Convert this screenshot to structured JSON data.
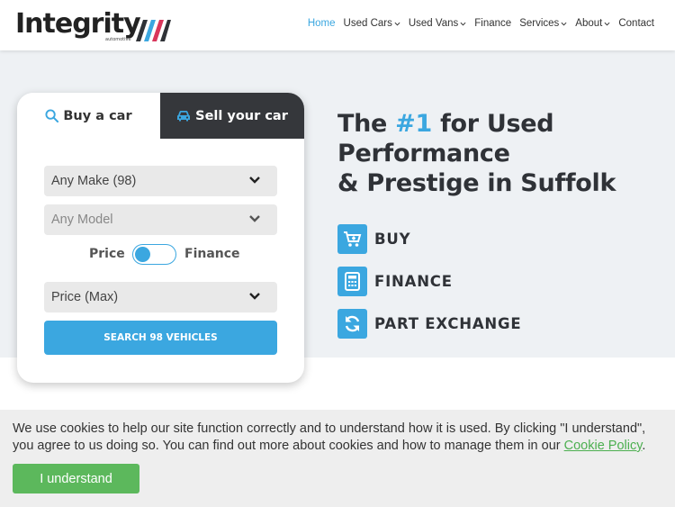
{
  "brand": {
    "name": "Integrity",
    "tagline": "automotive",
    "stripe_colors": [
      "#2f3237",
      "#3ba7e0",
      "#d9365b"
    ]
  },
  "nav": {
    "items": [
      {
        "label": "Home",
        "active": true,
        "dropdown": false
      },
      {
        "label": "Used Cars",
        "active": false,
        "dropdown": true
      },
      {
        "label": "Used Vans",
        "active": false,
        "dropdown": true
      },
      {
        "label": "Finance",
        "active": false,
        "dropdown": false
      },
      {
        "label": "Services",
        "active": false,
        "dropdown": true
      },
      {
        "label": "About",
        "active": false,
        "dropdown": true
      },
      {
        "label": "Contact",
        "active": false,
        "dropdown": false
      }
    ]
  },
  "search": {
    "tabs": {
      "buy": "Buy a car",
      "sell": "Sell your car"
    },
    "make": "Any Make (98)",
    "model": "Any Model",
    "toggle": {
      "left": "Price",
      "right": "Finance"
    },
    "price": "Price (Max)",
    "button": "SEARCH 98 VEHICLES"
  },
  "hero": {
    "line1_pre": "The ",
    "line1_accent": "#1",
    "line1_post": " for Used",
    "line2": "Performance",
    "line3": "& Prestige in Suffolk",
    "features": [
      {
        "label": "BUY",
        "icon": "cart-icon"
      },
      {
        "label": "FINANCE",
        "icon": "calculator-icon"
      },
      {
        "label": "PART EXCHANGE",
        "icon": "sync-icon"
      }
    ]
  },
  "cookie": {
    "text": "We use cookies to help our site function correctly and to understand how it is used. By clicking \"I understand\", you agree to us doing so. You can find out more about cookies and how to manage them in our ",
    "link": "Cookie Policy",
    "suffix": ".",
    "button": "I understand"
  },
  "colors": {
    "accent": "#3ba7e0",
    "dark": "#35373b",
    "cookie_button": "#5cb85c",
    "link": "#4caf50"
  }
}
